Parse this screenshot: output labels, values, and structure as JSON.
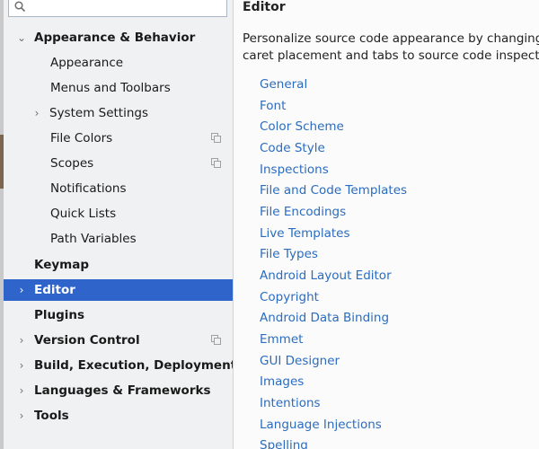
{
  "search": {
    "value": "",
    "placeholder": ""
  },
  "sidebar": {
    "items": [
      {
        "label": "Appearance & Behavior",
        "expanded": true
      },
      {
        "label": "Appearance"
      },
      {
        "label": "Menus and Toolbars"
      },
      {
        "label": "System Settings"
      },
      {
        "label": "File Colors"
      },
      {
        "label": "Scopes"
      },
      {
        "label": "Notifications"
      },
      {
        "label": "Quick Lists"
      },
      {
        "label": "Path Variables"
      },
      {
        "label": "Keymap"
      },
      {
        "label": "Editor",
        "selected": true
      },
      {
        "label": "Plugins"
      },
      {
        "label": "Version Control"
      },
      {
        "label": "Build, Execution, Deployment"
      },
      {
        "label": "Languages & Frameworks"
      },
      {
        "label": "Tools"
      }
    ]
  },
  "main": {
    "title": "Editor",
    "description_line1": "Personalize source code appearance by changing",
    "description_line2": "caret placement and tabs to source code inspectio",
    "links": [
      "General",
      "Font",
      "Color Scheme",
      "Code Style",
      "Inspections",
      "File and Code Templates",
      "File Encodings",
      "Live Templates",
      "File Types",
      "Android Layout Editor",
      "Copyright",
      "Android Data Binding",
      "Emmet",
      "GUI Designer",
      "Images",
      "Intentions",
      "Language Injections",
      "Spelling"
    ]
  },
  "colors": {
    "selection": "#2f65ca",
    "link": "#2a6cc0",
    "sidebar_bg": "#f0f1f2"
  }
}
